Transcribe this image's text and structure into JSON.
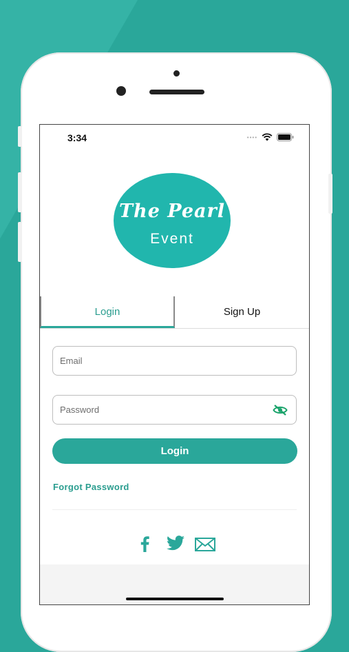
{
  "status_bar": {
    "time": "3:34"
  },
  "logo": {
    "line1": "The Pearl",
    "line2": "Event"
  },
  "tabs": [
    {
      "label": "Login"
    },
    {
      "label": "Sign Up"
    }
  ],
  "form": {
    "email_placeholder": "Email",
    "password_placeholder": "Password",
    "login_label": "Login",
    "forgot_label": "Forgot Password"
  },
  "social": [
    "facebook-icon",
    "twitter-icon",
    "mail-icon"
  ],
  "colors": {
    "accent": "#2aa79a",
    "background": "#2aa79a",
    "logo": "#21b6ad"
  }
}
